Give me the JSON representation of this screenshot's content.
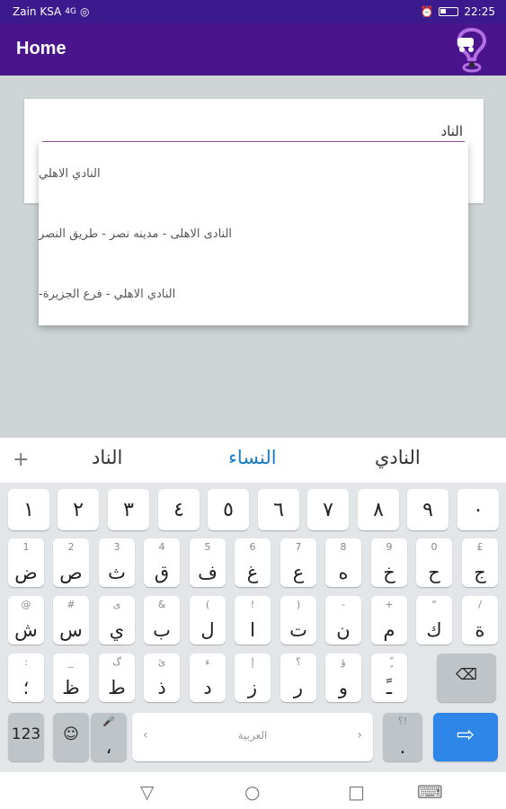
{
  "status_bar": {
    "carrier": "Zain KSA",
    "signal": "4G",
    "time": "22:25"
  },
  "app_bar": {
    "title": "Home"
  },
  "search": {
    "value": "الناد",
    "placeholder": ""
  },
  "dropdown": {
    "items": [
      {
        "label": "النادي الاهلي"
      },
      {
        "label": "النادى الاهلى - مدينه نصر - طريق النصر"
      },
      {
        "label": "النادي الاهلي - فرع الجزيرة-"
      }
    ]
  },
  "suggestions": {
    "plus": "+",
    "left": "الناد",
    "middle": "النساء",
    "right": "النادي"
  },
  "keyboard": {
    "row1": [
      "١",
      "٢",
      "٣",
      "٤",
      "٥",
      "٦",
      "٧",
      "٨",
      "٩",
      "٠"
    ],
    "row2": [
      {
        "hint": "1",
        "main": "ض"
      },
      {
        "hint": "2",
        "main": "ص"
      },
      {
        "hint": "3",
        "main": "ث"
      },
      {
        "hint": "4",
        "main": "ق"
      },
      {
        "hint": "5",
        "main": "ف"
      },
      {
        "hint": "6",
        "main": "غ"
      },
      {
        "hint": "7",
        "main": "ع"
      },
      {
        "hint": "8",
        "main": "ه"
      },
      {
        "hint": "9",
        "main": "خ"
      },
      {
        "hint": "0",
        "main": "ح"
      },
      {
        "hint": "£",
        "main": "ج"
      }
    ],
    "row3": [
      {
        "hint": "@",
        "main": "ش"
      },
      {
        "hint": "#",
        "main": "س"
      },
      {
        "hint": "ى",
        "main": "ي"
      },
      {
        "hint": "&",
        "main": "ب"
      },
      {
        "hint": "(",
        "main": "ل"
      },
      {
        "hint": "!",
        "main": "ا"
      },
      {
        "hint": ")",
        "main": "ت"
      },
      {
        "hint": "-",
        "main": "ن"
      },
      {
        "hint": "+",
        "main": "م"
      },
      {
        "hint": "\"",
        "main": "ك"
      },
      {
        "hint": "/",
        "main": "ة"
      }
    ],
    "row4": [
      {
        "hint": ":",
        "main": "؛"
      },
      {
        "hint": "_",
        "main": "ظ"
      },
      {
        "hint": "گ",
        "main": "ط"
      },
      {
        "hint": "ئ",
        "main": "ذ"
      },
      {
        "hint": "ء",
        "main": "د"
      },
      {
        "hint": "إ",
        "main": "ز"
      },
      {
        "hint": "؟",
        "main": "ر"
      },
      {
        "hint": "ؤ",
        "main": "و"
      },
      {
        "hint": "ٍّ",
        "main": "ـً"
      }
    ],
    "numbers_key": "123",
    "emoji_key": "☺",
    "comma_key": {
      "hint": "🎤",
      "main": "،"
    },
    "space_label": "العربية",
    "space_left": "‹",
    "space_right": "›",
    "period_key": {
      "hint": "؟!",
      "main": "."
    },
    "backspace_icon": "⌫",
    "enter_icon": "⇨"
  },
  "nav_bar": {
    "back": "▽",
    "home": "○",
    "recents": "□",
    "keyboard": "⌨"
  },
  "colors": {
    "status": "#3a1a8c",
    "app_bar": "#4a148c",
    "underline": "#9c5ba8",
    "suggest_active": "#1a7cc9",
    "enter": "#2e86e8"
  }
}
